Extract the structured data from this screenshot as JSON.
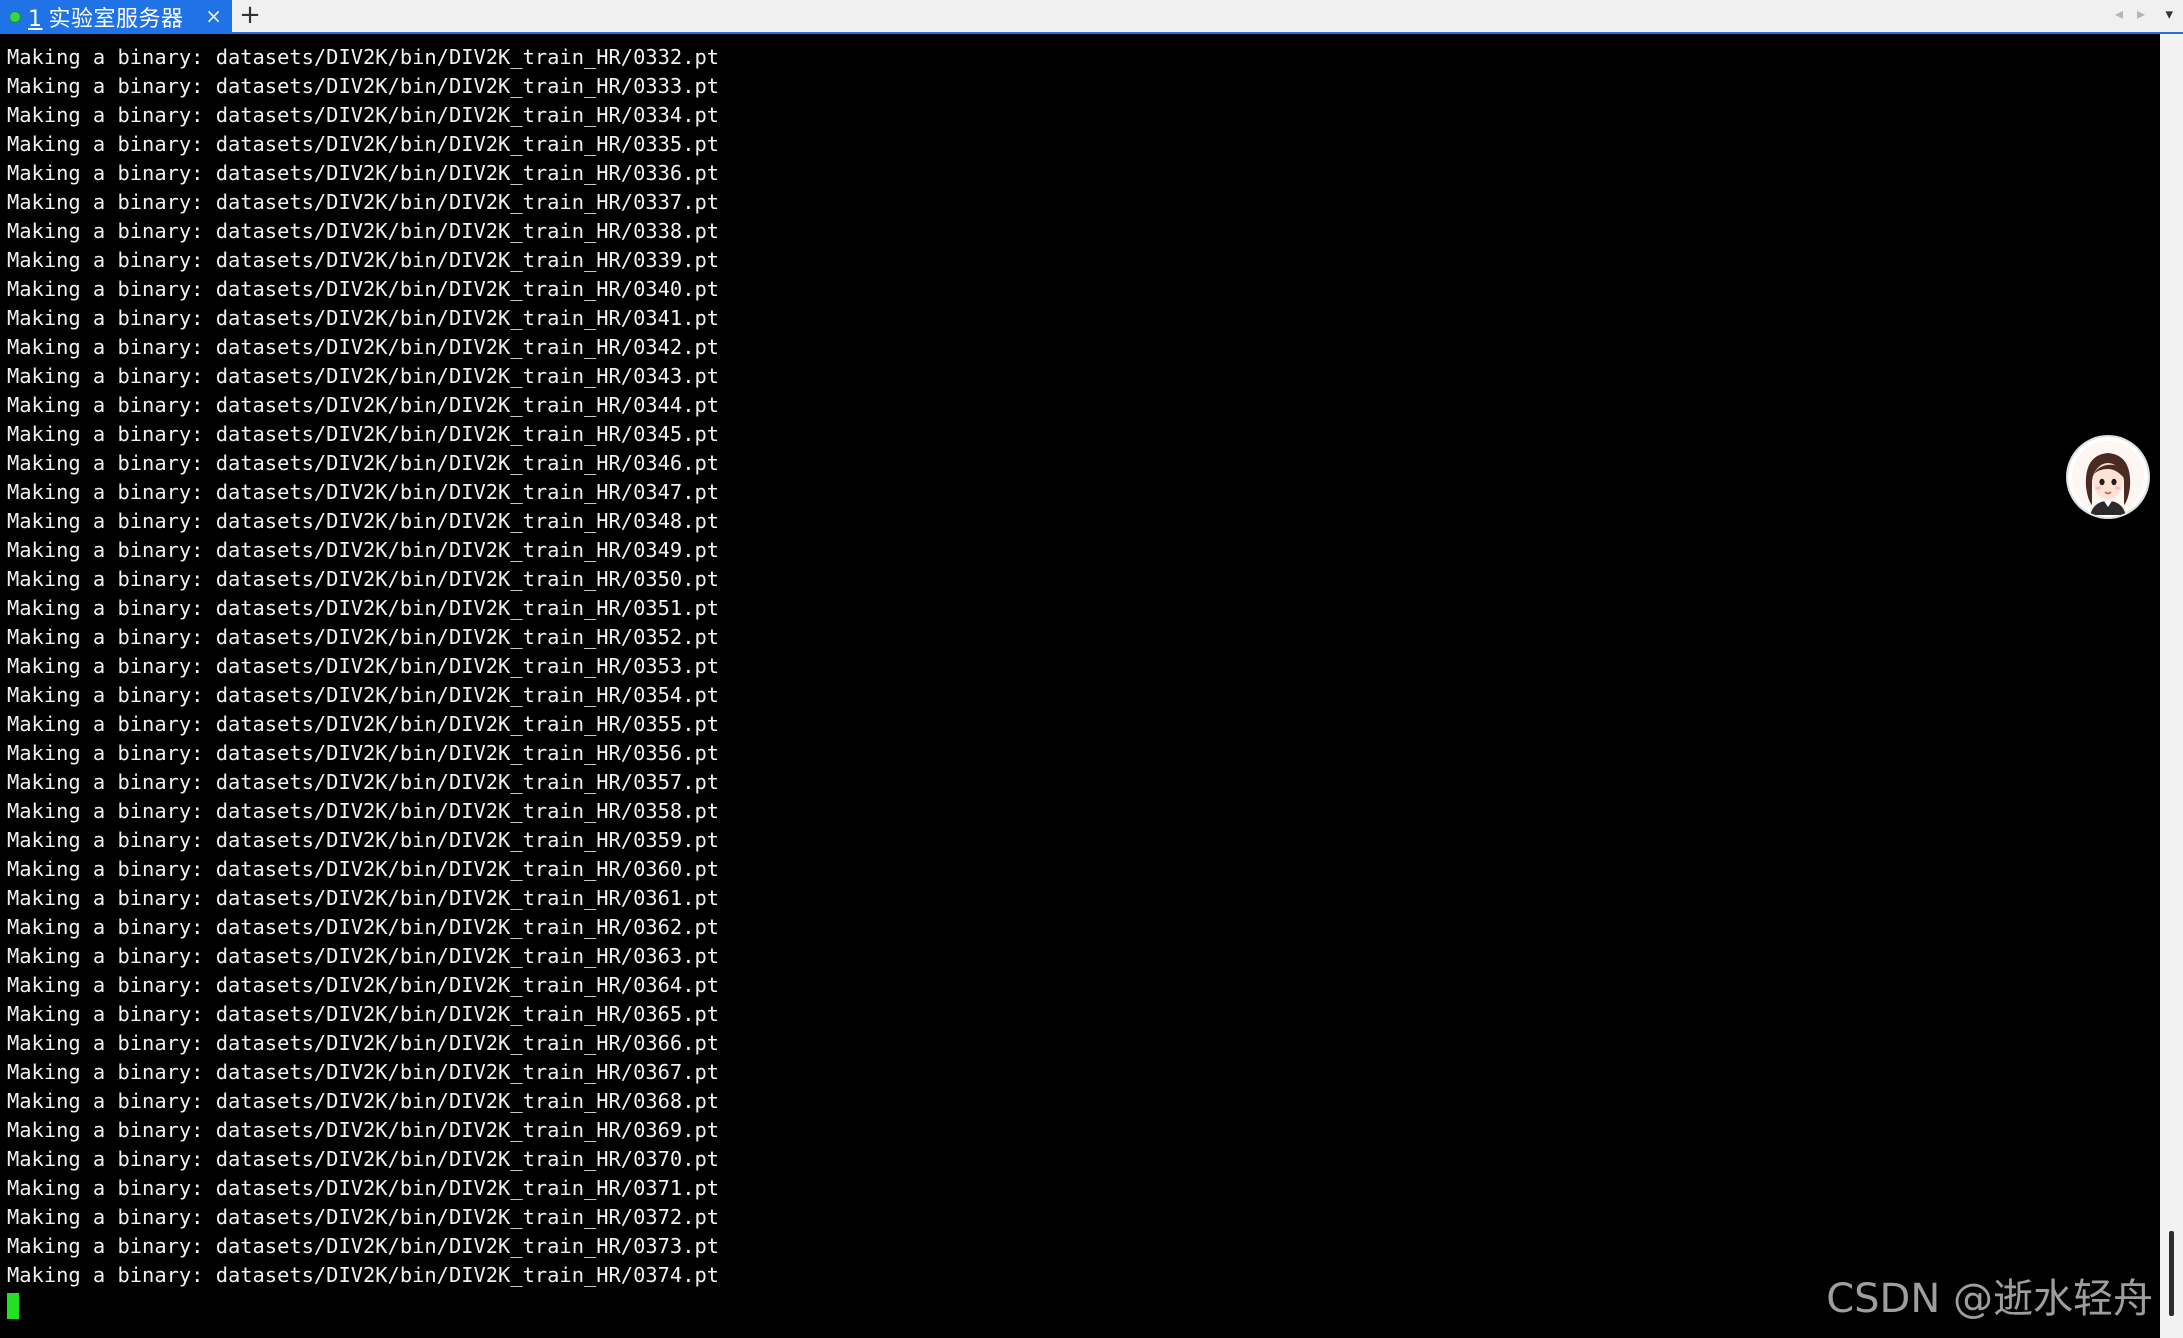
{
  "tab": {
    "number": "1",
    "title": "实验室服务器",
    "close_glyph": "×",
    "status_color": "#39d353"
  },
  "new_tab_glyph": "+",
  "tab_nav": {
    "left_glyph": "◂",
    "right_glyph": "▸",
    "menu_glyph": "▾"
  },
  "terminal": {
    "lines": [
      "Making a binary: datasets/DIV2K/bin/DIV2K_train_HR/0332.pt",
      "Making a binary: datasets/DIV2K/bin/DIV2K_train_HR/0333.pt",
      "Making a binary: datasets/DIV2K/bin/DIV2K_train_HR/0334.pt",
      "Making a binary: datasets/DIV2K/bin/DIV2K_train_HR/0335.pt",
      "Making a binary: datasets/DIV2K/bin/DIV2K_train_HR/0336.pt",
      "Making a binary: datasets/DIV2K/bin/DIV2K_train_HR/0337.pt",
      "Making a binary: datasets/DIV2K/bin/DIV2K_train_HR/0338.pt",
      "Making a binary: datasets/DIV2K/bin/DIV2K_train_HR/0339.pt",
      "Making a binary: datasets/DIV2K/bin/DIV2K_train_HR/0340.pt",
      "Making a binary: datasets/DIV2K/bin/DIV2K_train_HR/0341.pt",
      "Making a binary: datasets/DIV2K/bin/DIV2K_train_HR/0342.pt",
      "Making a binary: datasets/DIV2K/bin/DIV2K_train_HR/0343.pt",
      "Making a binary: datasets/DIV2K/bin/DIV2K_train_HR/0344.pt",
      "Making a binary: datasets/DIV2K/bin/DIV2K_train_HR/0345.pt",
      "Making a binary: datasets/DIV2K/bin/DIV2K_train_HR/0346.pt",
      "Making a binary: datasets/DIV2K/bin/DIV2K_train_HR/0347.pt",
      "Making a binary: datasets/DIV2K/bin/DIV2K_train_HR/0348.pt",
      "Making a binary: datasets/DIV2K/bin/DIV2K_train_HR/0349.pt",
      "Making a binary: datasets/DIV2K/bin/DIV2K_train_HR/0350.pt",
      "Making a binary: datasets/DIV2K/bin/DIV2K_train_HR/0351.pt",
      "Making a binary: datasets/DIV2K/bin/DIV2K_train_HR/0352.pt",
      "Making a binary: datasets/DIV2K/bin/DIV2K_train_HR/0353.pt",
      "Making a binary: datasets/DIV2K/bin/DIV2K_train_HR/0354.pt",
      "Making a binary: datasets/DIV2K/bin/DIV2K_train_HR/0355.pt",
      "Making a binary: datasets/DIV2K/bin/DIV2K_train_HR/0356.pt",
      "Making a binary: datasets/DIV2K/bin/DIV2K_train_HR/0357.pt",
      "Making a binary: datasets/DIV2K/bin/DIV2K_train_HR/0358.pt",
      "Making a binary: datasets/DIV2K/bin/DIV2K_train_HR/0359.pt",
      "Making a binary: datasets/DIV2K/bin/DIV2K_train_HR/0360.pt",
      "Making a binary: datasets/DIV2K/bin/DIV2K_train_HR/0361.pt",
      "Making a binary: datasets/DIV2K/bin/DIV2K_train_HR/0362.pt",
      "Making a binary: datasets/DIV2K/bin/DIV2K_train_HR/0363.pt",
      "Making a binary: datasets/DIV2K/bin/DIV2K_train_HR/0364.pt",
      "Making a binary: datasets/DIV2K/bin/DIV2K_train_HR/0365.pt",
      "Making a binary: datasets/DIV2K/bin/DIV2K_train_HR/0366.pt",
      "Making a binary: datasets/DIV2K/bin/DIV2K_train_HR/0367.pt",
      "Making a binary: datasets/DIV2K/bin/DIV2K_train_HR/0368.pt",
      "Making a binary: datasets/DIV2K/bin/DIV2K_train_HR/0369.pt",
      "Making a binary: datasets/DIV2K/bin/DIV2K_train_HR/0370.pt",
      "Making a binary: datasets/DIV2K/bin/DIV2K_train_HR/0371.pt",
      "Making a binary: datasets/DIV2K/bin/DIV2K_train_HR/0372.pt",
      "Making a binary: datasets/DIV2K/bin/DIV2K_train_HR/0373.pt",
      "Making a binary: datasets/DIV2K/bin/DIV2K_train_HR/0374.pt"
    ],
    "cursor_color": "#22e022"
  },
  "avatar": {
    "icon": "assistant-avatar-icon"
  },
  "watermark": {
    "text": "CSDN @逝水轻舟"
  }
}
